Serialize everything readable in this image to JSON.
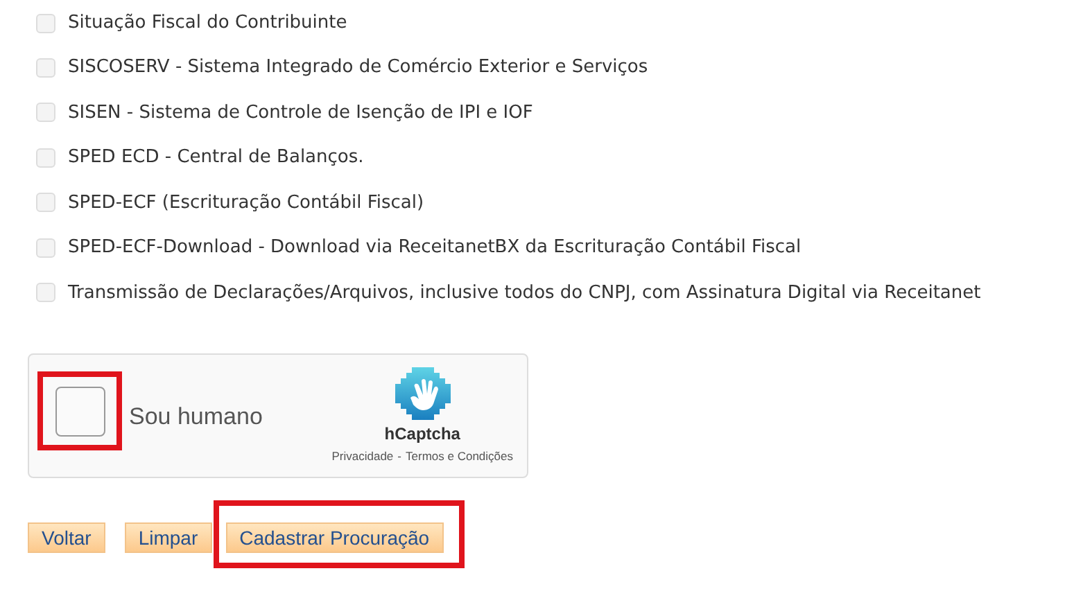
{
  "options": [
    {
      "label": "Situação Fiscal do Contribuinte",
      "checked": false
    },
    {
      "label": "SISCOSERV - Sistema Integrado de Comércio Exterior e Serviços",
      "checked": false
    },
    {
      "label": "SISEN - Sistema de Controle de Isenção de IPI e IOF",
      "checked": false
    },
    {
      "label": "SPED ECD - Central de Balanços.",
      "checked": false
    },
    {
      "label": "SPED-ECF (Escrituração Contábil Fiscal)",
      "checked": false
    },
    {
      "label": "SPED-ECF-Download - Download via ReceitanetBX da Escrituração Contábil Fiscal",
      "checked": false
    },
    {
      "label": "Transmissão de Declarações/Arquivos, inclusive todos do CNPJ, com Assinatura Digital via Receitanet",
      "checked": false
    }
  ],
  "captcha": {
    "label": "Sou humano",
    "checked": false,
    "highlighted": true,
    "brand": "hCaptcha",
    "privacy_link": "Privacidade",
    "separator": "-",
    "terms_link": "Termos e Condições"
  },
  "buttons": [
    {
      "label": "Voltar",
      "highlighted": false
    },
    {
      "label": "Limpar",
      "highlighted": false
    },
    {
      "label": "Cadastrar Procuração",
      "highlighted": true
    }
  ]
}
